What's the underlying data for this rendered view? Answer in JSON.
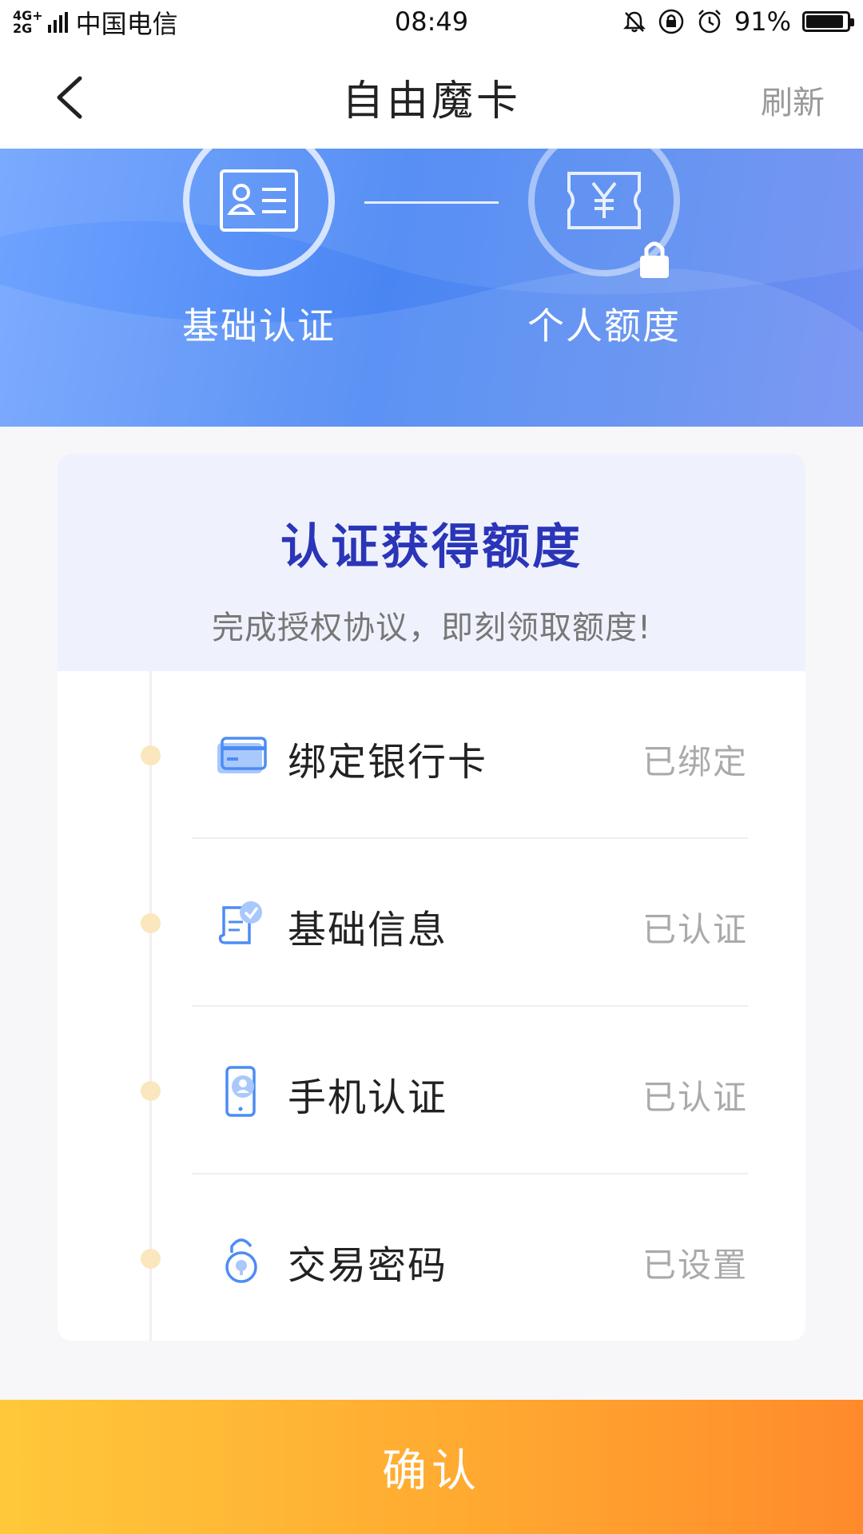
{
  "status_bar": {
    "network_top": "4G+",
    "network_bottom": "2G",
    "carrier": "中国电信",
    "time": "08:49",
    "battery": "91%"
  },
  "header": {
    "title": "自由魔卡",
    "refresh": "刷新"
  },
  "steps": [
    {
      "label": "基础认证",
      "icon": "id-card-icon"
    },
    {
      "label": "个人额度",
      "icon": "yen-ticket-icon",
      "locked": true
    }
  ],
  "card": {
    "title": "认证获得额度",
    "subtitle": "完成授权协议，即刻领取额度!",
    "items": [
      {
        "label": "绑定银行卡",
        "status": "已绑定",
        "icon": "bank-card-icon"
      },
      {
        "label": "基础信息",
        "status": "已认证",
        "icon": "info-document-icon"
      },
      {
        "label": "手机认证",
        "status": "已认证",
        "icon": "phone-verify-icon"
      },
      {
        "label": "交易密码",
        "status": "已设置",
        "icon": "password-lock-icon"
      }
    ]
  },
  "confirm_label": "确认",
  "colors": {
    "title_blue": "#2a35b8",
    "banner_blue": "#4a86f3",
    "button_orange": "#ffa630",
    "timeline_dot": "#fbe7bd"
  }
}
